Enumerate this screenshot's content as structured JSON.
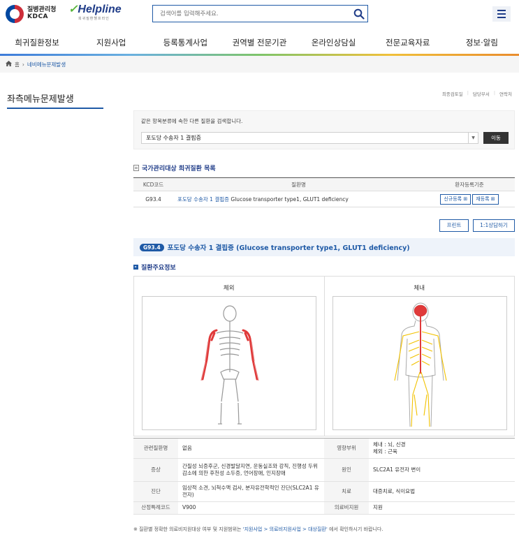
{
  "header": {
    "kdca_name_ko": "질병관리청",
    "kdca_name_en": "KDCA",
    "helpline_logo": "Helpline",
    "helpline_sub": "희귀질환헬프라인",
    "search_placeholder": "검색어를 입력해주세요.",
    "search_icon": "search-icon",
    "menu_icon": "hamburger-icon"
  },
  "gnb": [
    "희귀질환정보",
    "지원사업",
    "등록통계사업",
    "권역별 전문기관",
    "온라인상담실",
    "전문교육자료",
    "정보·알림"
  ],
  "breadcrumb": {
    "home": "홈",
    "current": "네비메뉴문제발생"
  },
  "left_title": "좌측메뉴문제발생",
  "util_links": [
    "최종검토일",
    "담당부서",
    "연락처"
  ],
  "filter": {
    "description": "같은 항목분류에 속한 다른 질환을 검색합니다.",
    "selected": "포도당 수송자 1 결핍증",
    "move_button": "이동"
  },
  "list_section": {
    "title": "국가관리대상 희귀질환 목록",
    "headers": [
      "KCD코드",
      "질환명",
      "환자등록기준"
    ],
    "row": {
      "code": "G93.4",
      "name_link": "포도당 수송자 1 결핍증",
      "name_en": " Glucose transporter type1, GLUT1 deficiency",
      "new_reg": "신규등록",
      "re_reg": "재등록"
    }
  },
  "buttons": {
    "print": "프린트",
    "consult": "1:1상담하기"
  },
  "disease": {
    "code": "G93.4",
    "name": "포도당 수송자 1 결핍증 (Glucose transporter type1, GLUT1 deficiency)"
  },
  "main_info": {
    "title": "질환주요정보",
    "external_label": "체외",
    "internal_label": "체내"
  },
  "info_table": {
    "related_k": "관련질환명",
    "related_v": "없음",
    "affected_k": "영향부위",
    "affected_v1": "체내 : 뇌, 신경",
    "affected_v2": "체외 : 근육",
    "symptom_k": "증상",
    "symptom_v": "간질성 뇌증후군, 신경발달지연, 운동실조와 강직, 진행성 두위 감소에 의한 후천성 소두증, 언어장애, 인지장애",
    "cause_k": "원인",
    "cause_v": "SLC2A1 유전자 변이",
    "diag_k": "진단",
    "diag_v": "임상적 소견, 뇌척수액 검사, 분자유전학적인 진단(SLC2A1 유전자)",
    "treat_k": "치료",
    "treat_v": "대증치료, 식이요법",
    "special_k": "산정특례코드",
    "special_v": "V900",
    "support_k": "의료비지원",
    "support_v": "지원"
  },
  "note": {
    "prefix": "※ 질환별 정확한 의료비지원대상 여부 및 지원범위는 ",
    "link": "'지원사업 > 의료비지원사업 > 대상질환'",
    "suffix": " 에서 확인하시기 바랍니다."
  }
}
